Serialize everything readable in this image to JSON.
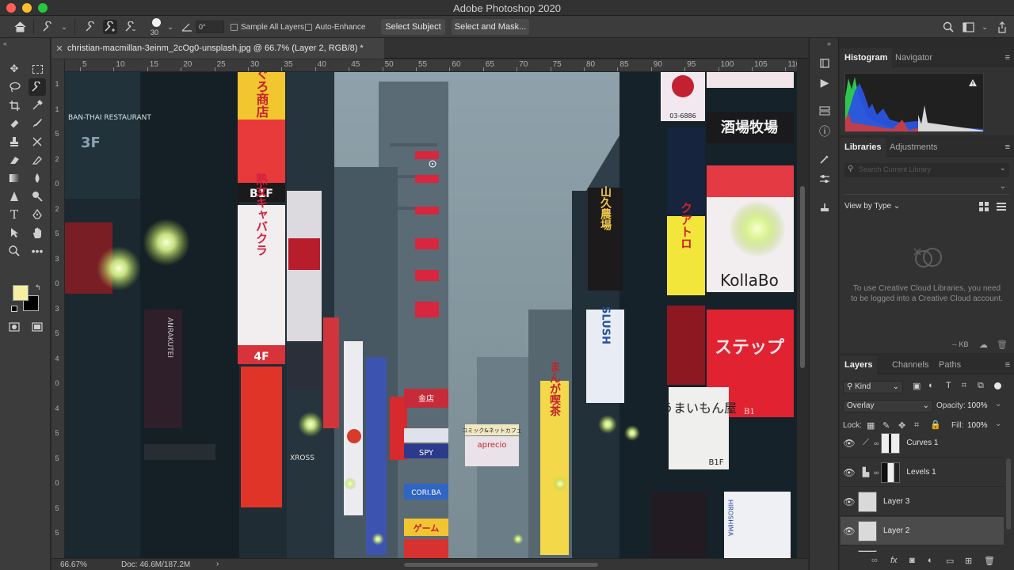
{
  "app": {
    "title": "Adobe Photoshop 2020",
    "colors": {
      "close": "#ff5f57",
      "minimize": "#febc2e",
      "zoom": "#28c840"
    }
  },
  "options": {
    "brush_size": "30",
    "angle": "0°",
    "sample_all_layers": "Sample All Layers",
    "auto_enhance": "Auto-Enhance",
    "select_subject": "Select Subject",
    "select_and_mask": "Select and Mask..."
  },
  "document": {
    "tab_title": "christian-macmillan-3einm_2cOg0-unsplash.jpg @ 66.7% (Layer 2, RGB/8) *",
    "zoom": "66.67%",
    "doc_size": "Doc: 46.6M/187.2M"
  },
  "ruler": {
    "h_ticks": [
      "5",
      "10",
      "15",
      "20",
      "25",
      "30",
      "35",
      "40",
      "45",
      "50",
      "55",
      "60",
      "65",
      "70",
      "75",
      "80",
      "85",
      "90",
      "95",
      "100",
      "105",
      "110"
    ],
    "v_ticks": [
      "1",
      "1",
      "5",
      "2",
      "0",
      "2",
      "5",
      "3",
      "0",
      "3",
      "5",
      "4",
      "0",
      "4",
      "5",
      "5",
      "0",
      "5",
      "5"
    ]
  },
  "canvas_signs": {
    "s1": "まぐろ商店",
    "s2": "B1F",
    "s3": "熟女キャバクラ",
    "s4": "4F",
    "s5": "酒場牧場",
    "s6": "KollaBo",
    "s7": "ステップ",
    "s8": "B1",
    "s9": "SLUSH",
    "s10": "まんが喫茶",
    "s11": "ゲーム",
    "s12": "ANRAKUTEI",
    "s13": "HIROSHIMA",
    "s14": "BAN-THAI RESTAURANT",
    "s15": "3F",
    "s16": "山久農場",
    "s17": "クアトロ",
    "s18": "CORI.BA",
    "s19": "うまいもん屋",
    "s20": "B1F",
    "s21": "SPY",
    "s22": "XROSS",
    "s23": "コミック&ネットカフェ",
    "s24": "aprecio",
    "s25": "03-6886",
    "s26": "金店"
  },
  "panels": {
    "histogram_tab": "Histogram",
    "navigator_tab": "Navigator",
    "libraries_tab": "Libraries",
    "adjustments_tab": "Adjustments",
    "search_placeholder": "Search Current Library",
    "view_by_type": "View by Type",
    "library_message": "To use Creative Cloud Libraries, you need to be logged into a Creative Cloud account.",
    "kb": "-- KB",
    "layers_tab": "Layers",
    "channels_tab": "Channels",
    "paths_tab": "Paths",
    "kind": "Kind",
    "blend_mode": "Overlay",
    "opacity_label": "Opacity:",
    "opacity_value": "100%",
    "lock_label": "Lock:",
    "fill_label": "Fill:",
    "fill_value": "100%",
    "layers": [
      "Curves 1",
      "Levels 1",
      "Layer 3",
      "Layer 2"
    ]
  }
}
